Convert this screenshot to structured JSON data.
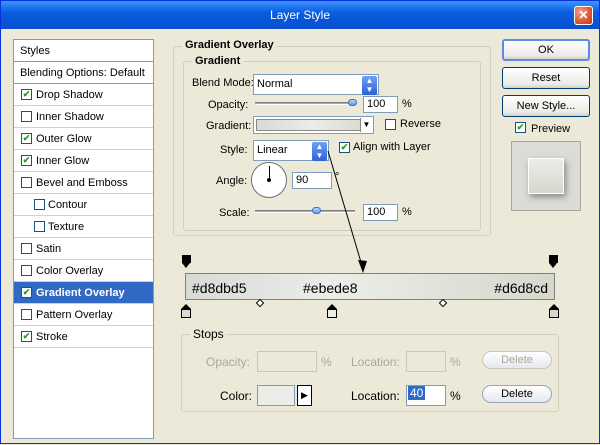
{
  "window": {
    "title": "Layer Style",
    "close_glyph": "✕"
  },
  "styles": [
    {
      "label": "Styles",
      "header": true
    },
    {
      "label": "Blending Options: Default",
      "header": true
    },
    {
      "label": "Drop Shadow",
      "checked": true
    },
    {
      "label": "Inner Shadow",
      "checked": false
    },
    {
      "label": "Outer Glow",
      "checked": true
    },
    {
      "label": "Inner Glow",
      "checked": true
    },
    {
      "label": "Bevel and Emboss",
      "checked": false
    },
    {
      "label": "Contour",
      "checked": false,
      "sub": true
    },
    {
      "label": "Texture",
      "checked": false,
      "sub": true
    },
    {
      "label": "Satin",
      "checked": false
    },
    {
      "label": "Color Overlay",
      "checked": false
    },
    {
      "label": "Gradient Overlay",
      "checked": true,
      "selected": true
    },
    {
      "label": "Pattern Overlay",
      "checked": false
    },
    {
      "label": "Stroke",
      "checked": true
    }
  ],
  "gradient_overlay": {
    "section_title": "Gradient Overlay",
    "group_title": "Gradient",
    "blend_mode_label": "Blend Mode:",
    "blend_mode_value": "Normal",
    "opacity_label": "Opacity:",
    "opacity_value": "100",
    "percent": "%",
    "gradient_label": "Gradient:",
    "reverse_label": "Reverse",
    "style_label": "Style:",
    "style_value": "Linear",
    "align_label": "Align with Layer",
    "angle_label": "Angle:",
    "angle_value": "90",
    "degree": "°",
    "scale_label": "Scale:",
    "scale_value": "100"
  },
  "gradient_editor": {
    "stop_colors": [
      "#d8dbd5",
      "#ebede8",
      "#d6d8cd"
    ],
    "stops_title": "Stops",
    "opacity_label": "Opacity:",
    "location_label": "Location:",
    "color_label": "Color:",
    "location_value": "40",
    "percent": "%",
    "delete_label": "Delete",
    "color_swatch": "#ebede8"
  },
  "buttons": {
    "ok": "OK",
    "reset": "Reset",
    "new_style": "New Style...",
    "preview": "Preview"
  },
  "colors": {
    "title_bar": "#0a5ee0",
    "selection": "#316ac5"
  }
}
